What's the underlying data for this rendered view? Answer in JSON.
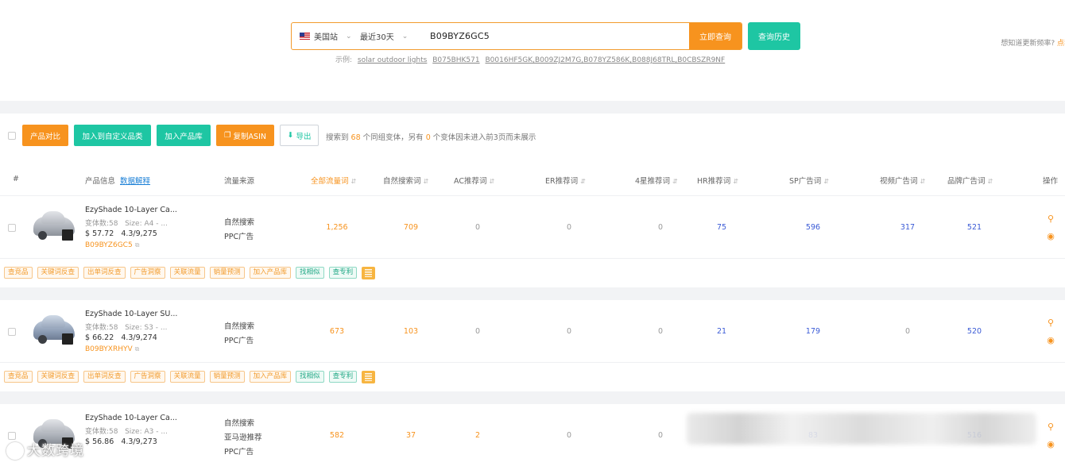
{
  "search": {
    "site": "美国站",
    "range": "最近30天",
    "query": "B09BYZ6GC5",
    "query_button": "立即查询",
    "history_button": "查询历史",
    "examples_label": "示例:",
    "examples": [
      "solar outdoor lights",
      "B075BHK571",
      "B0016HF5GK,B009ZJ2M7G,B078YZ586K,B088J68TRL,B0CBSZR9NF"
    ],
    "update_note": "想知道更新频率? ",
    "update_link": "点我"
  },
  "toolbar": {
    "compare": "产品对比",
    "add_category": "加入到自定义品类",
    "add_library": "加入产品库",
    "copy_asin": "复制ASIN",
    "export": "导出",
    "msg_prefix": "搜索到",
    "msg_count": "68",
    "msg_mid": "个同组变体，另有",
    "msg_count2": "0",
    "msg_suffix": "个变体因未进入前3页而未展示"
  },
  "columns": {
    "hash": "#",
    "product": "产品信息",
    "product_link": "数据解释",
    "source": "流量来源",
    "all": "全部流量词",
    "natural": "自然搜索词",
    "ac": "AC推荐词",
    "er": "ER推荐词",
    "star4": "4星推荐词",
    "hr": "HR推荐词",
    "sp": "SP广告词",
    "video": "视频广告词",
    "brand": "品牌广告词",
    "action": "操作"
  },
  "tag_labels": {
    "t1": "查竞品",
    "t2": "关键词反查",
    "t3": "出单词反查",
    "t4": "广告洞察",
    "t5": "关联流量",
    "t6": "销量预测",
    "t7": "加入产品库",
    "t8": "找相似",
    "t9": "查专利"
  },
  "rows": [
    {
      "title": "EzyShade 10-Layer Ca...",
      "variants": "变体数:58",
      "size": "Size: A4 - ...",
      "price": "$ 57.72",
      "rating": "4.3/9,275",
      "asin": "B09BYZ6GC5",
      "source1": "自然搜索",
      "source2": "PPC广告",
      "source3": "",
      "all": "1,256",
      "natural": "709",
      "ac": "0",
      "er": "0",
      "star4": "0",
      "hr": "75",
      "sp": "596",
      "video": "317",
      "brand": "521"
    },
    {
      "title": "EzyShade 10-Layer SU...",
      "variants": "变体数:58",
      "size": "Size: S3 - ...",
      "price": "$ 66.22",
      "rating": "4.3/9,274",
      "asin": "B09BYXRHYV",
      "source1": "自然搜索",
      "source2": "PPC广告",
      "source3": "",
      "all": "673",
      "natural": "103",
      "ac": "0",
      "er": "0",
      "star4": "0",
      "hr": "21",
      "sp": "179",
      "video": "0",
      "brand": "520"
    },
    {
      "title": "EzyShade 10-Layer Ca...",
      "variants": "变体数:58",
      "size": "Size: A3 - ...",
      "price": "$ 56.86",
      "rating": "4.3/9,273",
      "asin": "",
      "source1": "自然搜索",
      "source2": "亚马逊推荐",
      "source3": "PPC广告",
      "all": "582",
      "natural": "37",
      "ac": "2",
      "er": "0",
      "star4": "0",
      "hr": "",
      "sp": "83",
      "video": "",
      "brand": "516"
    }
  ],
  "watermark": "大数跨境",
  "icons": {
    "search": "magnifier-icon",
    "locate": "location-pin-icon",
    "external": "external-link-icon"
  },
  "colors": {
    "accent_orange": "#f7931e",
    "accent_green": "#1ec6a3",
    "value_blue": "#3b5bd6"
  }
}
